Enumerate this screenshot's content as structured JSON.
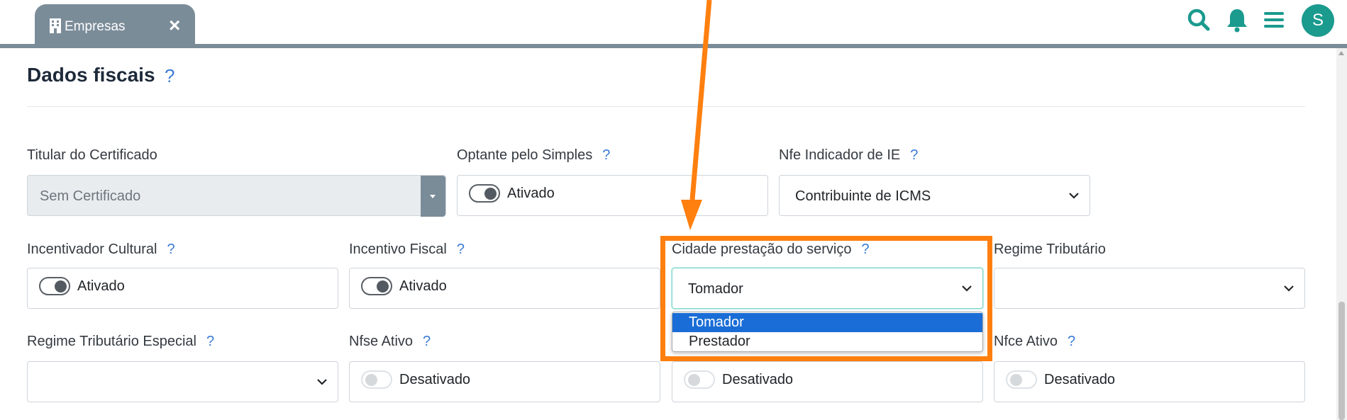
{
  "tab": {
    "label": "Empresas",
    "icon": "building-icon",
    "close_icon": "close-icon"
  },
  "header_icons": [
    "search-icon",
    "bell-icon",
    "menu-icon"
  ],
  "avatar": {
    "initial": "S"
  },
  "section": {
    "title": "Dados fiscais",
    "help": "?"
  },
  "fields": {
    "titular": {
      "label": "Titular do Certificado",
      "value": "Sem Certificado"
    },
    "optante": {
      "label": "Optante pelo Simples",
      "help": "?",
      "state": "Ativado"
    },
    "nfe_ie": {
      "label": "Nfe Indicador de IE",
      "help": "?",
      "value": "Contribuinte de ICMS"
    },
    "incentivador": {
      "label": "Incentivador Cultural",
      "help": "?",
      "state": "Ativado"
    },
    "incentivo": {
      "label": "Incentivo Fiscal",
      "help": "?",
      "state": "Ativado"
    },
    "cidade": {
      "label": "Cidade prestação do serviço",
      "help": "?",
      "value": "Tomador",
      "options": [
        "Tomador",
        "Prestador"
      ]
    },
    "regime": {
      "label": "Regime Tributário",
      "value": ""
    },
    "regime_especial": {
      "label": "Regime Tributário Especial",
      "help": "?",
      "value": ""
    },
    "nfse": {
      "label": "Nfse Ativo",
      "help": "?",
      "state": "Desativado"
    },
    "hidden_toggle": {
      "state": "Desativado"
    },
    "nfce": {
      "label": "Nfce Ativo",
      "help": "?",
      "state": "Desativado"
    }
  },
  "colors": {
    "accent": "#1b9a8e",
    "highlight": "#ff7f0f",
    "selected_option": "#1a6dd6",
    "help": "#3a7bd5"
  }
}
